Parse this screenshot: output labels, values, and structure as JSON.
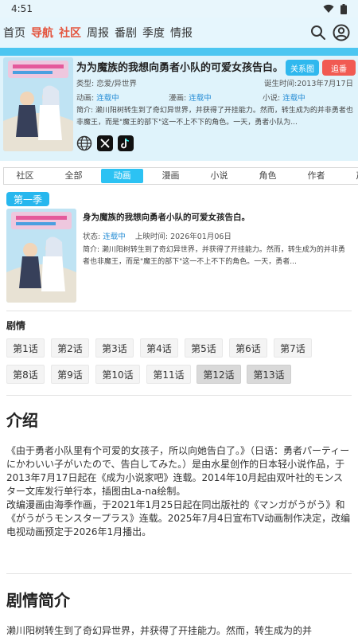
{
  "status_bar": {
    "time": "4:51"
  },
  "nav": {
    "items": [
      "首页",
      "导航",
      "社区",
      "周报",
      "番剧",
      "季度",
      "情报"
    ]
  },
  "header": {
    "title": "为为魔族的我想向勇者小队的可爱女孩告白。",
    "relation_button": "关系图",
    "follow_button": "追番",
    "type_label": "类型:",
    "type_value": "恋爱/异世界",
    "birth_label": "诞生时间:",
    "birth_value": "2013年7月17日",
    "anime_label": "动画:",
    "anime_value": "连载中",
    "manga_label": "漫画:",
    "manga_value": "连载中",
    "novel_label": "小说:",
    "novel_value": "连载中",
    "synopsis": "简介: 濑川阳树转生到了奇幻异世界，并获得了开挂能力。然而，转生成为的并非勇者也非魔王，而是\"魔王的部下\"这一不上不下的角色。一天，勇者小队为..."
  },
  "tabs": [
    "社区",
    "全部",
    "动画",
    "漫画",
    "小说",
    "角色",
    "作者",
    "声优"
  ],
  "season": {
    "badge": "第一季",
    "title": "身为魔族的我想向勇者小队的可爱女孩告白。",
    "status_label": "状态:",
    "status_value": "连载中",
    "date_label": "上映时间:",
    "date_value": "2026年01月06日",
    "synopsis": "简介: 濑川阳树转生到了奇幻异世界，并获得了开挂能力。然而，转生成为的并非勇者也非魔王，而是\"魔王的部下\"这一不上不下的角色。一天，勇者..."
  },
  "episodes": {
    "label": "剧情",
    "items": [
      "第1话",
      "第2话",
      "第3话",
      "第4话",
      "第5话",
      "第6话",
      "第7话",
      "第8话",
      "第9话",
      "第10话",
      "第11话",
      "第12话",
      "第13话"
    ]
  },
  "intro": {
    "heading": "介绍",
    "text": "《由于勇者小队里有个可爱的女孩子，所以向她告白了。》（日语：勇者パーティーにかわいい子がいたので、告白してみた。）是由水星创作的日本轻小说作品，于2013年7月17日起在《成为小说家吧》连载。2014年10月起由双叶社的モンスター文库发行单行本，插图由La-na绘制。\n改编漫画由海季作画，于2021年1月25日起在同出版社的《マンガがうがう》和《がうがうモンスタープラス》连载。2025年7月4日宣布TV动画制作决定，改编电视动画预定于2026年1月播出。"
  },
  "plot": {
    "heading": "剧情简介",
    "text": "濑川阳树转生到了奇幻异世界，并获得了开挂能力。然而，转生成为的并"
  },
  "colors": {
    "accent_blue": "#2cc2f3",
    "nav_active": "#e4553f",
    "follow_red": "#f15a52",
    "link_blue": "#2a8fd6"
  }
}
